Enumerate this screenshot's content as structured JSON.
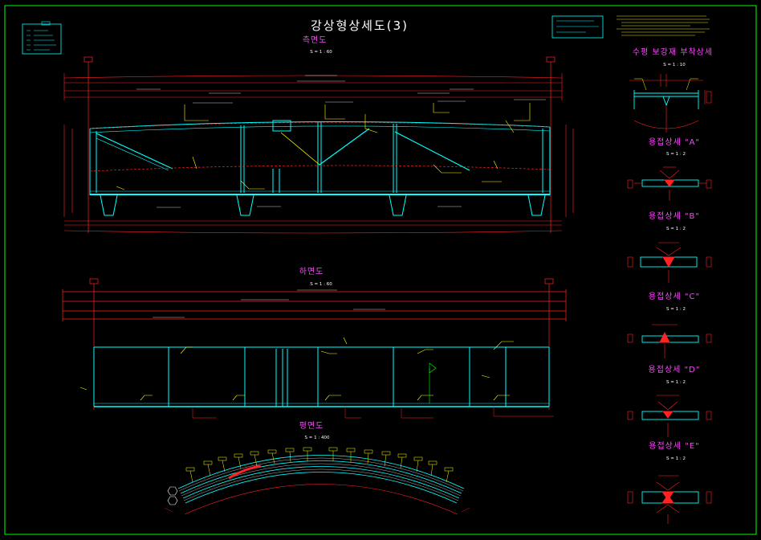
{
  "sheet": {
    "title": "강상형상세도(3)",
    "colors": {
      "background": "#000000",
      "border": "#00ff00",
      "steel": "#00ffff",
      "dimension": "#ff2222",
      "leader": "#ffff00",
      "heading": "#ff44ff",
      "text": "#ffffff"
    }
  },
  "views": {
    "side": {
      "title": "측면도",
      "scale": "S = 1 : 60"
    },
    "bottom": {
      "title": "하면도",
      "scale": "S = 1 : 60"
    },
    "plan": {
      "title": "평면도",
      "scale": "S = 1 : 400"
    }
  },
  "details": [
    {
      "title": "수평 보강재 부착상세",
      "scale": "S = 1 : 10"
    },
    {
      "title": "용접상세 \"A\"",
      "scale": "S = 1 : 2"
    },
    {
      "title": "용접상세 \"B\"",
      "scale": "S = 1 : 2"
    },
    {
      "title": "용접상세 \"C\"",
      "scale": "S = 1 : 2"
    },
    {
      "title": "용접상세 \"D\"",
      "scale": "S = 1 : 2"
    },
    {
      "title": "용접상세 \"E\"",
      "scale": "S = 1 : 2"
    }
  ]
}
